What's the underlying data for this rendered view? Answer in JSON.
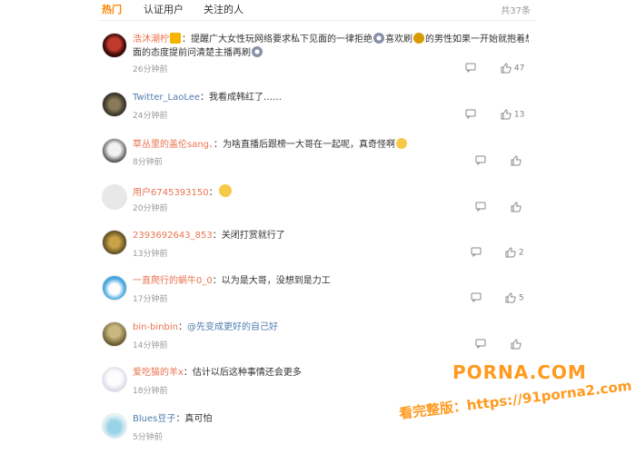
{
  "tabs": [
    {
      "label": "热门"
    },
    {
      "label": "认证用户"
    },
    {
      "label": "关注的人"
    }
  ],
  "total": "共37条",
  "comments": [
    {
      "username": "浩沐潮柠",
      "text_a": "：提醒广大女性玩网络要求私下见面的一律拒绝",
      "text_b": "喜欢刷",
      "text_c": "的男性如果一开始就抱着想见",
      "text_d": "面的态度提前问清楚主播再刷",
      "time": "26分钟前",
      "likes": "47"
    },
    {
      "username": "Twitter_LaoLee",
      "text": "：我看成韩红了……",
      "time": "24分钟前",
      "likes": "13"
    },
    {
      "username": "草丛里的盖伦sang、",
      "text": "：为啥直播后跟榜一大哥在一起呢，真奇怪啊",
      "time": "8分钟前",
      "likes": ""
    },
    {
      "username": "用户6745393150",
      "text": "：",
      "time": "20分钟前",
      "likes": ""
    },
    {
      "username": "2393692643_853",
      "text": "：关闭打赏就行了",
      "time": "13分钟前",
      "likes": "2"
    },
    {
      "username": "一直爬行的蜗牛0_0",
      "text": "：以为是大哥，没想到是力工",
      "time": "17分钟前",
      "likes": "5"
    },
    {
      "username": "bin-binbin",
      "text": "：",
      "mention": "@先变成更好的自己好",
      "time": "14分钟前",
      "likes": ""
    },
    {
      "username": "爱吃猫的羊x",
      "text": "：估计以后这种事情还会更多",
      "time": "18分钟前",
      "likes": ""
    },
    {
      "username": "Blues豆子",
      "text": "：真可怕",
      "time": "5分钟前",
      "likes": ""
    }
  ],
  "watermark": {
    "site": "PORNA.COM",
    "line2": "看完整版：https://91porna2.com"
  },
  "colors": {
    "accent": "#ff8200",
    "username": "#eb7350",
    "link": "#507daf",
    "watermark": "#ff9a1f"
  }
}
